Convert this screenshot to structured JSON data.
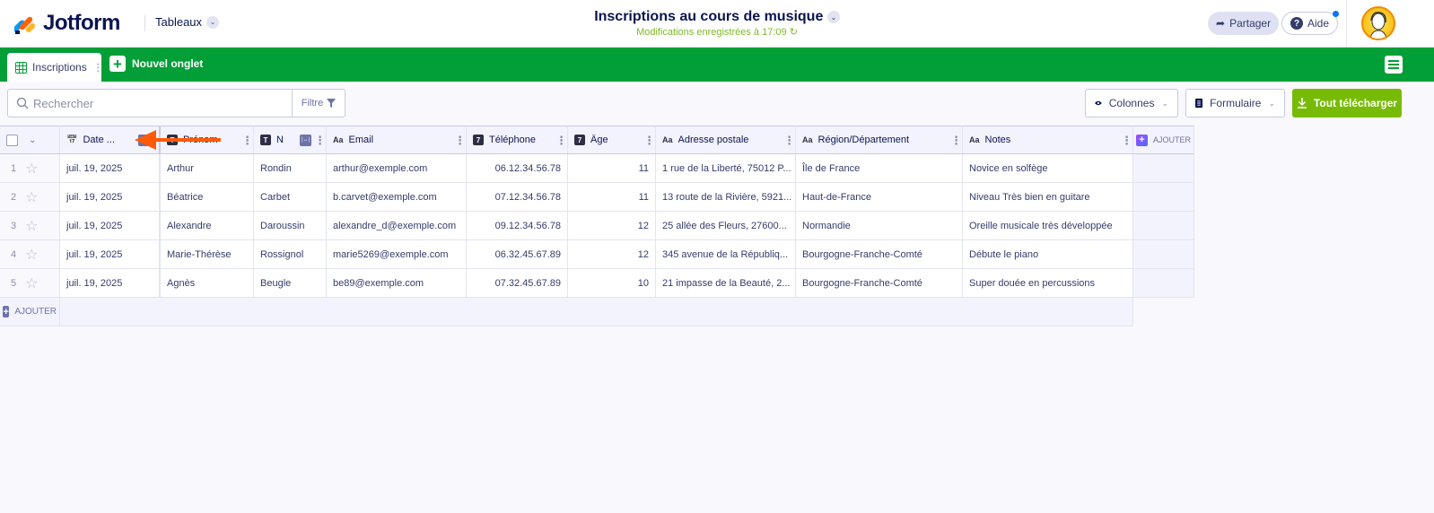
{
  "header": {
    "brand": "Jotform",
    "tables_menu": "Tableaux",
    "title": "Inscriptions au cours de musique",
    "saved_status": "Modifications enregistrées à 17:09",
    "share_label": "Partager",
    "help_label": "Aide"
  },
  "tabs": {
    "active": "Inscriptions",
    "new_tab": "Nouvel onglet"
  },
  "toolbar": {
    "search_placeholder": "Rechercher",
    "filter_label": "Filtre",
    "columns_label": "Colonnes",
    "form_label": "Formulaire",
    "download_label": "Tout télécharger"
  },
  "colors": {
    "brand_green": "#029e38",
    "download_green": "#78bb07",
    "navy": "#0a1551",
    "annotation_arrow": "#ff5a0a"
  },
  "table": {
    "columns": [
      {
        "label": "Date ...",
        "type": "date"
      },
      {
        "label": "Prénom",
        "type": "text"
      },
      {
        "label": "N",
        "type": "text"
      },
      {
        "label": "Email",
        "type": "string"
      },
      {
        "label": "Téléphone",
        "type": "number"
      },
      {
        "label": "Âge",
        "type": "number"
      },
      {
        "label": "Adresse postale",
        "type": "string"
      },
      {
        "label": "Région/Département",
        "type": "string"
      },
      {
        "label": "Notes",
        "type": "string"
      }
    ],
    "rows": [
      {
        "index": "1",
        "cells": [
          "juil. 19, 2025",
          "Arthur",
          "Rondin",
          "arthur@exemple.com",
          "06.12.34.56.78",
          "11",
          "1 rue de la Liberté, 75012 P...",
          "Île de France",
          "Novice en solfège"
        ]
      },
      {
        "index": "2",
        "cells": [
          "juil. 19, 2025",
          "Béatrice",
          "Carbet",
          "b.carvet@exemple.com",
          "07.12.34.56.78",
          "11",
          "13 route de la Rivière, 5921...",
          "Haut-de-France",
          "Niveau Très bien en guitare"
        ]
      },
      {
        "index": "3",
        "cells": [
          "juil. 19, 2025",
          "Alexandre",
          "Daroussin",
          "alexandre_d@exemple.com",
          "09.12.34.56.78",
          "12",
          "25 allée des Fleurs, 27600...",
          "Normandie",
          "Oreille musicale très développée"
        ]
      },
      {
        "index": "4",
        "cells": [
          "juil. 19, 2025",
          "Marie-Thérèse",
          "Rossignol",
          "marie5269@exemple.com",
          "06.32.45.67.89",
          "12",
          "345 avenue de la Républiq...",
          "Bourgogne-Franche-Comté",
          "Débute le piano"
        ]
      },
      {
        "index": "5",
        "cells": [
          "juil. 19, 2025",
          "Agnès",
          "Beugle",
          "be89@exemple.com",
          "07.32.45.67.89",
          "10",
          "21 impasse de la Beauté, 2...",
          "Bourgogne-Franche-Comté",
          "Super douée en percussions"
        ]
      }
    ],
    "add_column_label": "AJOUTER",
    "add_row_label": "AJOUTER"
  }
}
